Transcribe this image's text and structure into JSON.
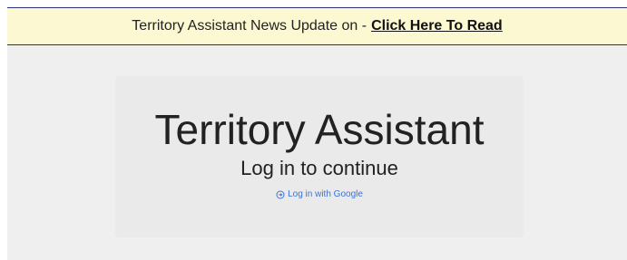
{
  "banner": {
    "text": "Territory Assistant News Update on -",
    "link_label": "Click Here To Read"
  },
  "login": {
    "title": "Territory Assistant",
    "subtitle": "Log in to continue",
    "google_button_label": "Log in with Google",
    "google_button_icon": "login-icon"
  },
  "colors": {
    "banner_background": "#fcf9d2",
    "banner_border": "#2c2f7a",
    "page_background": "#efefef",
    "card_background": "#ebeaea",
    "link_blue": "#3b73d6"
  }
}
